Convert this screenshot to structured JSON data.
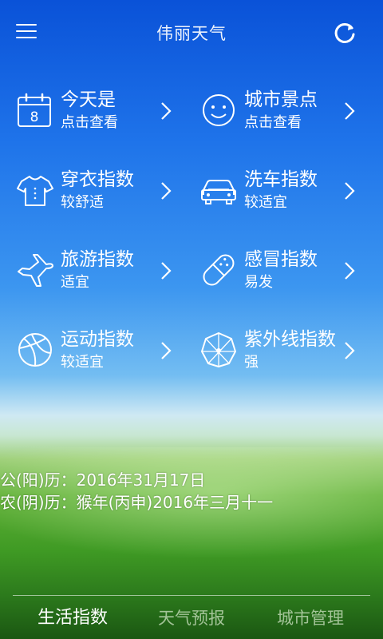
{
  "header": {
    "title": "伟丽天气"
  },
  "tiles": [
    {
      "name": "today",
      "icon": "calendar-icon",
      "title": "今天是",
      "subtitle": "点击查看",
      "calendar_day": "8"
    },
    {
      "name": "city-attractions",
      "icon": "smiley-icon",
      "title": "城市景点",
      "subtitle": "点击查看"
    },
    {
      "name": "dressing-index",
      "icon": "tshirt-icon",
      "title": "穿衣指数",
      "subtitle": "较舒适"
    },
    {
      "name": "car-wash-index",
      "icon": "car-icon",
      "title": "洗车指数",
      "subtitle": "较适宜"
    },
    {
      "name": "travel-index",
      "icon": "airplane-icon",
      "title": "旅游指数",
      "subtitle": "适宜"
    },
    {
      "name": "cold-index",
      "icon": "pill-icon",
      "title": "感冒指数",
      "subtitle": "易发"
    },
    {
      "name": "sport-index",
      "icon": "basketball-icon",
      "title": "运动指数",
      "subtitle": "较适宜"
    },
    {
      "name": "uv-index",
      "icon": "umbrella-icon",
      "title": "紫外线指数",
      "subtitle": "强"
    }
  ],
  "calendar": {
    "solar": "公(阳)历：2016年31月17日",
    "lunar": "农(阴)历：猴年(丙申)2016年三月十一"
  },
  "tabs": [
    {
      "label": "生活指数",
      "active": true
    },
    {
      "label": "天气预报",
      "active": false
    },
    {
      "label": "城市管理",
      "active": false
    }
  ]
}
